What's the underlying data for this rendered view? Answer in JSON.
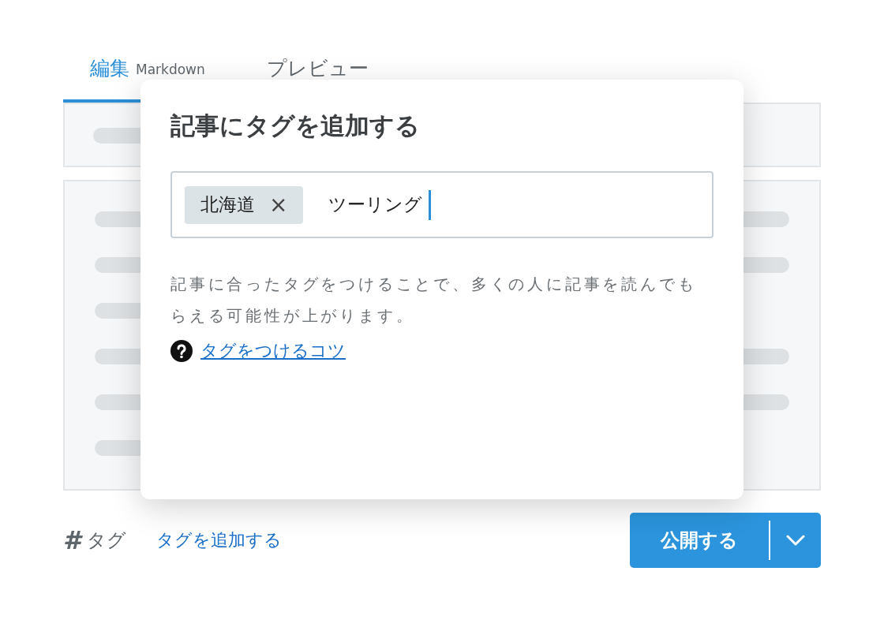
{
  "tabs": [
    {
      "label": "編集",
      "sublabel": "Markdown",
      "selected": true
    },
    {
      "label": "プレビュー",
      "selected": false
    }
  ],
  "dialog": {
    "title": "記事にタグを追加する",
    "tags": [
      {
        "label": "北海道",
        "remove": "×"
      }
    ],
    "input_value": "ツーリング",
    "description": "記事に合ったタグをつけることで、多くの人に記事を読んでもらえる可能性が上がります。",
    "help_link": "タグをつけるコツ"
  },
  "footer": {
    "tag_icon": "#",
    "tag_label": "タグ",
    "add_tag_link": "タグを追加する",
    "publish_button": "公開する"
  }
}
